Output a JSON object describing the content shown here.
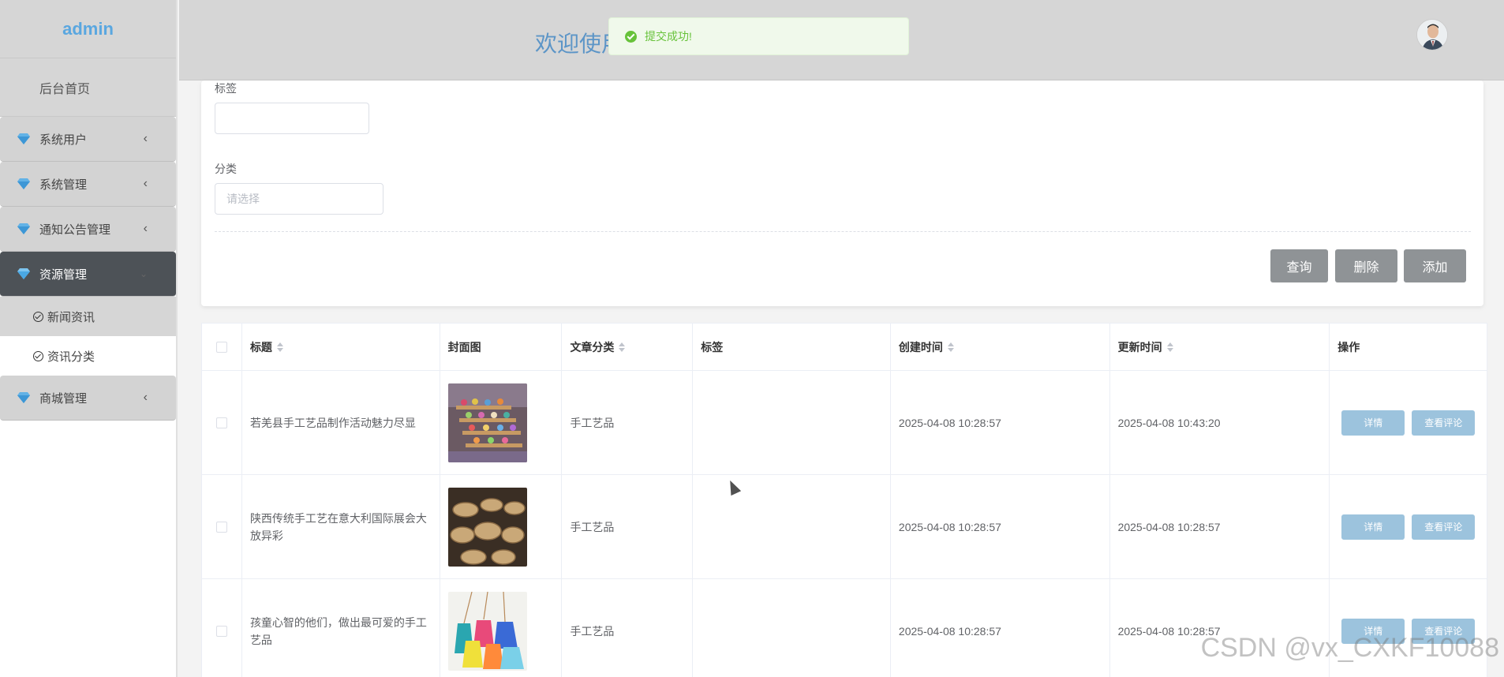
{
  "brand": "admin",
  "header": {
    "welcome": "欢迎使用",
    "avatar_alt": "avatar"
  },
  "toast": {
    "message": "提交成功!"
  },
  "sidebar": {
    "home": "后台首页",
    "groups": [
      {
        "label": "系统用户",
        "icon": "gem-icon"
      },
      {
        "label": "系统管理",
        "icon": "gem-icon"
      },
      {
        "label": "通知公告管理",
        "icon": "gem-icon"
      },
      {
        "label": "资源管理",
        "icon": "gem-icon",
        "expanded": true
      },
      {
        "label": "商城管理",
        "icon": "gem-icon"
      }
    ],
    "subitems": [
      {
        "label": "新闻资讯",
        "selected": true
      },
      {
        "label": "资讯分类",
        "selected": false
      }
    ]
  },
  "search": {
    "tag_label": "标签",
    "tag_value": "",
    "category_label": "分类",
    "category_placeholder": "请选择",
    "query_button": "查询",
    "delete_button": "删除",
    "add_button": "添加"
  },
  "table": {
    "columns": [
      "标题",
      "封面图",
      "文章分类",
      "标签",
      "创建时间",
      "更新时间",
      "操作"
    ],
    "rows": [
      {
        "title": "若羌县手工艺品制作活动魅力尽显",
        "category": "手工艺品",
        "tag": "",
        "created": "2025-04-08 10:28:57",
        "updated": "2025-04-08 10:43:20"
      },
      {
        "title": "陕西传统手工艺在意大利国际展会大放异彩",
        "category": "手工艺品",
        "tag": "",
        "created": "2025-04-08 10:28:57",
        "updated": "2025-04-08 10:28:57"
      },
      {
        "title": "孩童心智的他们，做出最可爱的手工艺品",
        "category": "手工艺品",
        "tag": "",
        "created": "2025-04-08 10:28:57",
        "updated": "2025-04-08 10:28:57"
      }
    ],
    "detail_button": "详情",
    "comment_button": "查看评论"
  },
  "watermark": "CSDN @vx_CXKF10088",
  "colors": {
    "sidebar_active": "#4d5257",
    "welcome": "#5c95c7",
    "action_button": "#9cc3dd",
    "toast_green": "#67c23a"
  }
}
